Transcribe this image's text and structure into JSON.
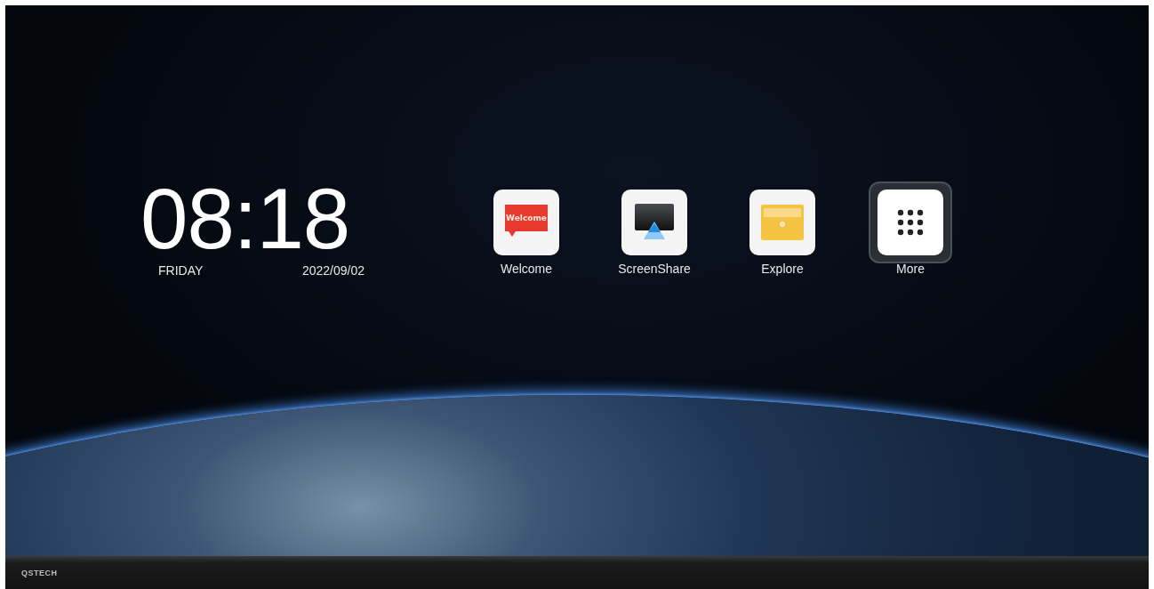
{
  "clock": {
    "time": "08:18",
    "weekday": "FRIDAY",
    "date": "2022/09/02"
  },
  "apps": [
    {
      "kind": "welcome",
      "label": "Welcome",
      "icon_text": "Welcome",
      "selected": false
    },
    {
      "kind": "screenshare",
      "label": "ScreenShare",
      "selected": false
    },
    {
      "kind": "folder",
      "label": "Explore",
      "selected": false
    },
    {
      "kind": "grid",
      "label": "More",
      "selected": true
    }
  ],
  "bezel": {
    "brand": "QSTECH"
  }
}
